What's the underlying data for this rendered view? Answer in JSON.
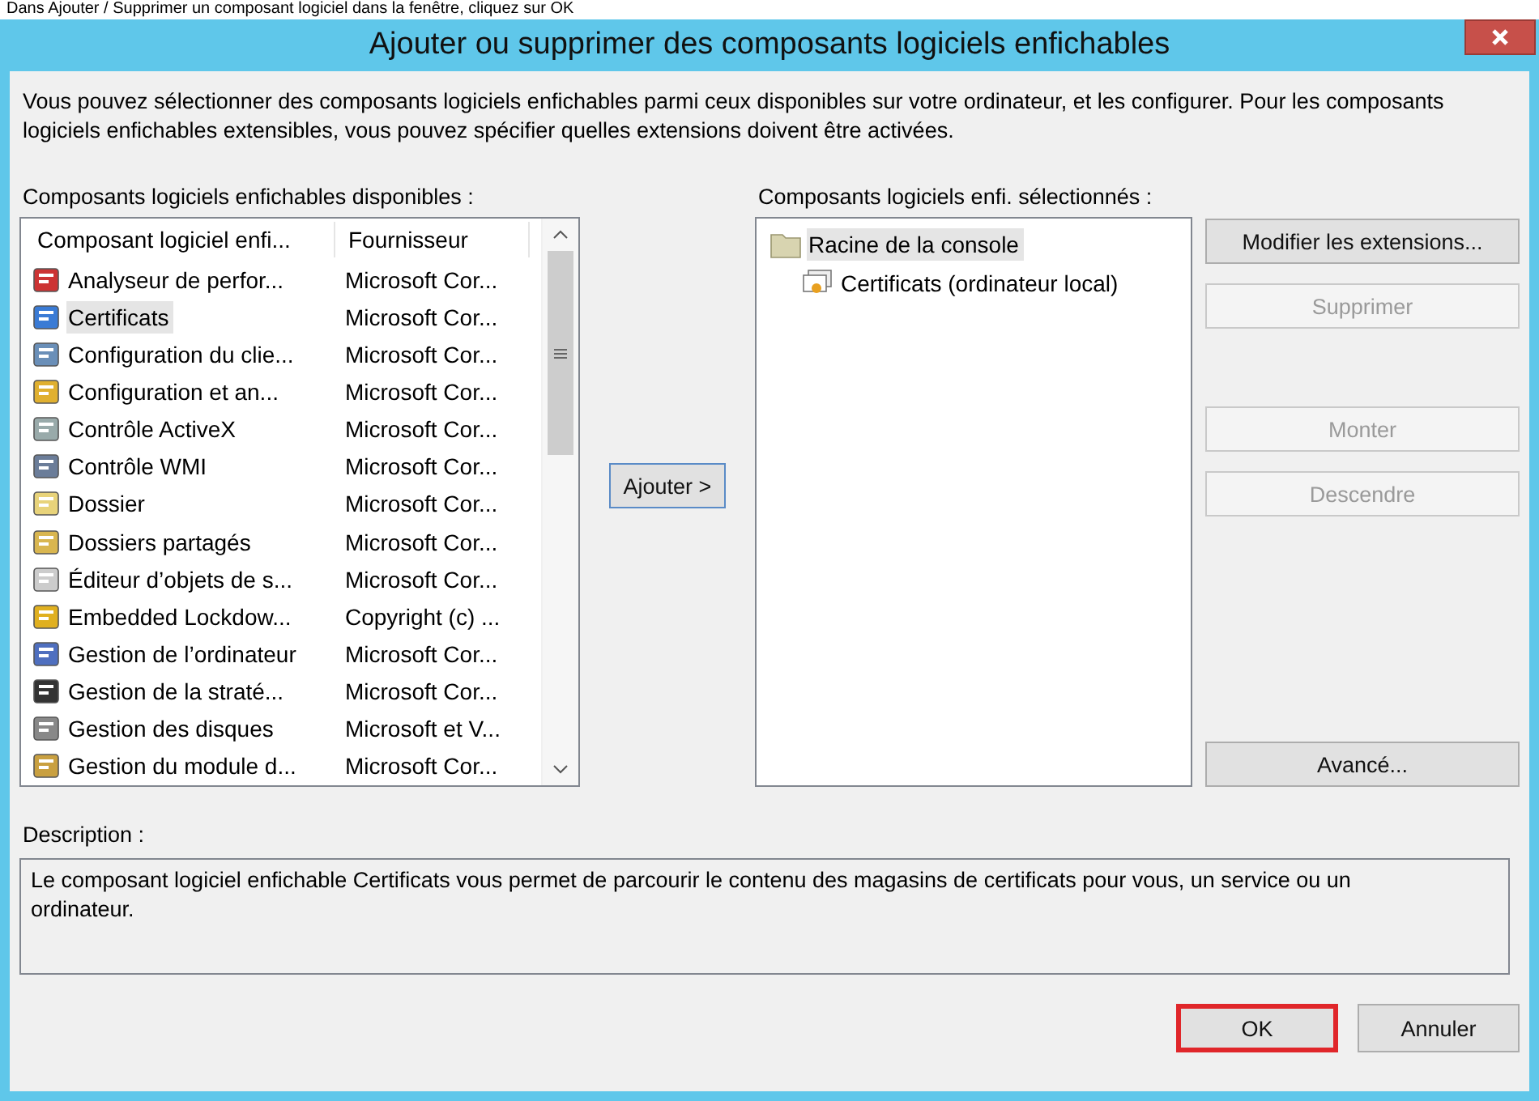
{
  "caption": "Dans Ajouter / Supprimer un composant logiciel dans la fenêtre, cliquez sur OK",
  "window": {
    "title": "Ajouter ou supprimer des composants logiciels enfichables"
  },
  "intro": "Vous pouvez sélectionner des composants logiciels enfichables parmi ceux disponibles sur votre ordinateur, et les configurer. Pour les composants logiciels enfichables extensibles, vous pouvez spécifier quelles extensions doivent être activées.",
  "available": {
    "label": "Composants logiciels enfichables disponibles :",
    "columns": [
      "Composant logiciel enfi...",
      "Fournisseur"
    ],
    "rows": [
      {
        "name": "Analyseur de perfor...",
        "vendor": "Microsoft Cor...",
        "selected": false
      },
      {
        "name": "Certificats",
        "vendor": "Microsoft Cor...",
        "selected": true
      },
      {
        "name": "Configuration du clie...",
        "vendor": "Microsoft Cor...",
        "selected": false
      },
      {
        "name": "Configuration et an...",
        "vendor": "Microsoft Cor...",
        "selected": false
      },
      {
        "name": "Contrôle ActiveX",
        "vendor": "Microsoft Cor...",
        "selected": false
      },
      {
        "name": "Contrôle WMI",
        "vendor": "Microsoft Cor...",
        "selected": false
      },
      {
        "name": "Dossier",
        "vendor": "Microsoft Cor...",
        "selected": false
      },
      {
        "name": "Dossiers partagés",
        "vendor": "Microsoft Cor...",
        "selected": false
      },
      {
        "name": "Éditeur d’objets de s...",
        "vendor": "Microsoft Cor...",
        "selected": false
      },
      {
        "name": "Embedded Lockdow...",
        "vendor": "Copyright (c) ...",
        "selected": false
      },
      {
        "name": "Gestion de l’ordinateur",
        "vendor": "Microsoft Cor...",
        "selected": false
      },
      {
        "name": "Gestion de la straté...",
        "vendor": "Microsoft Cor...",
        "selected": false
      },
      {
        "name": "Gestion des disques",
        "vendor": "Microsoft et V...",
        "selected": false
      },
      {
        "name": "Gestion du module d...",
        "vendor": "Microsoft Cor...",
        "selected": false
      }
    ]
  },
  "add_button": "Ajouter >",
  "selected_list": {
    "label": "Composants logiciels enfi. sélectionnés :",
    "tree": [
      {
        "name": "Racine de la console",
        "selected": true,
        "children": [
          {
            "name": "Certificats (ordinateur local)",
            "selected": false
          }
        ]
      }
    ]
  },
  "side_buttons": [
    {
      "label": "Modifier les extensions...",
      "disabled": false
    },
    {
      "label": "Supprimer",
      "disabled": true
    },
    {
      "label": "Monter",
      "disabled": true
    },
    {
      "label": "Descendre",
      "disabled": true
    }
  ],
  "advanced_button": {
    "label": "Avancé...",
    "disabled": false
  },
  "description": {
    "label": "Description :",
    "text": "Le composant logiciel enfichable Certificats vous permet de parcourir le contenu des magasins de certificats pour vous, un service ou un ordinateur."
  },
  "footer_buttons": [
    {
      "label": "OK",
      "highlighted": true
    },
    {
      "label": "Annuler",
      "highlighted": false
    }
  ]
}
